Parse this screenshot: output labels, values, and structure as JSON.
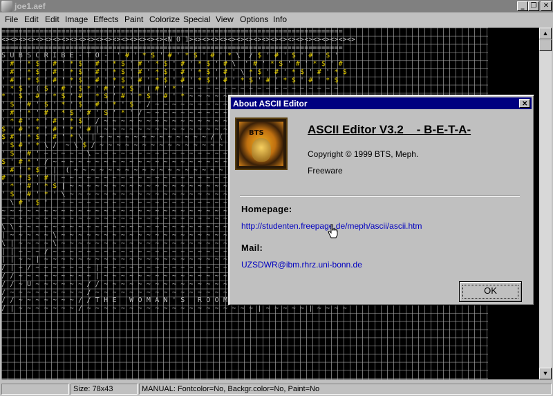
{
  "window": {
    "title": "joe1.aef",
    "controls": [
      "minimize",
      "restore",
      "close"
    ]
  },
  "menu": [
    "File",
    "Edit",
    "Edit",
    "Image",
    "Effects",
    "Paint",
    "Colorize",
    "Special",
    "View",
    "Options",
    "Info"
  ],
  "canvas": {
    "rows": [
      "================================================================================",
      "<><><><><><><><><><><><><><><><><><><><N 0 1><><><><><><><><><><><><><><><><><><><>",
      "================================================================================",
      "S U B S C R I B E - T O -  ' # ' * $ ' # ' * $ ' # ' * \\  / $ ' # ' $ ' # ' $ '",
      "' # ' * $ ' # ' * $ ' # ' * $ ' # ' * $ ' # ' * $ ' # \\  ' # ' * $ ' # ' * $ ' #",
      "' # ' * $ ' # ' * $ ' # ' * $ ' # ' * $ ' # ' * $ ' # ' \\ * $ ' # ' * $ ' # ' * $",
      "' # ' * $ ' # ' * $ ' # ' * $ ' # ' * $ ' # ' * $ ' # ' * $ ' # ' * $ ' # ' * $",
      "' * $ ' ( $ ' # ' $ * ' # ' * $ ' ( # ' * ' ~ ~ ~ ~ ~ ~ ~ ~ ~ ~ ~ ~ ~ ~ ~ ~ ~ ~",
      "* ' $ ' # ' * $ ' # ' * $ ' # ' * $ ' # ' * ~ ~ ~ ~ ~ ~ ~ ~ ~ ~ ~ ~ ~ ~ ~ ~ ~ ~ ~",
      "' $ ' # ' $ ' * ' $ ' # ' * ' $ ' / ~ ~ ~ ~ ~ ~ ~ ~ ~ ~ ~ ~ ~ ~ ~ ~ ~ ~ ~ ~ ~ ~ ~",
      "' # ' * ' # ' * $ ' # ' $ ' * ' / ~ ~ ~ ~ ~ ~ ~ ~ ~ ~ ~ ~ ~ ~ ~ ~ ~ ~ ~ ~ ~ ~ ~ ~",
      "' * # ' * ' # ' * $ ' / ~ ~ ~ ~ ~ ~ ~ ~ ~ ~ ~ ~ ~ ~ ~ ~ ~ ~ ~ ~ ~ ~ ~ ~ ~ ~ ~ ~ ~",
      "$ ' # ' * ' # ' * ' # | ~ ~ ~ ~ ~ ~ ~ ~ ~ ~ ~ ~ ~ ~ ~ ~ ~ ~ ~ ~ ~ ~ ~ ~ ~ ~ ~ ~ ~",
      "$ # ' * $ ' # ' * \\  | ~ ~ ~ ~ ~ ~ ~ ~ ~ ~ ~ ~ ~ / ( 0 | ~ ~ ~ ~ ~ ~ ~ ~ ~ ~ ~ ~",
      "' $ # ' * \\ /  ~ \\ $ / ~ ~ ~ ~ ~ ~ ~ ~ ~ ~ ~ ~ ~ ~ ~ ~ ~ ~ ~ ~ ~ ~ ~ ~ ~ ~ ~ ~ ~",
      "' $ ' # ' ~ ~ ~ ~ ~ \\ ~ ~ ~ ~ ~ ~ ~ ~ ~ ~ ~ ~ ~ ~ ~ ~ ~ ~ ~ ~ ~ ~ ~ ~ ~ ~ ~ ~ ~",
      "$ ' # * ' / ~ ~ ~ ~ ~ ~ ~ ~ ~ ~ ~ ~ ~ ~ ~ ~ ~ ~ ~ ~ ~ ~ ~ ~ ~ ~ ~ ~ ~ ~ ~ ~ ~ ~",
      "' # ' * $ ' |  ( ~ ~ ~ ~ ~ ~ ~ ~ ~ ~ ~ ~ ~ ~ ~ ~ ~ ~ ~ ~ ~ ~ ~ ~ ~ ~ ~ ~ ~ ~ ~ ~",
      "# ' * $ ' # | ~ ~ ~ ~ ~ ~ ~ ~ ~ ~ ~ ~ ~ ~ ~ ~ ~ ~ ~ ~ ~ ~ ~ ~ ~ ~ ~ ~ ~ ~ ~ ~ ~",
      "' * ' # ' * $ | ~ ~ ~ ~ ~ ~ ~ ~ ~ ~ ~ ~ ~ ~ ~ ~ ~ ~ ~ ~ ~ ~ ~ ~ ~ ~ ~ ~ ~ ~ ~ ~",
      "' $ ' # ' * ' \\ ~ ~ ~ ~ ~ ~ ~ ~ ~ ~ ~ ~ ~ ~ ~ ~ ~ ~ ~ ~ ~ ~ ~ ~ ~ ~ ~ ~ ~ ~ ~ ~",
      "  \\ # ' $ '   ~ ~ ~ ~ ~ ~ ~ ~ ~ ~ ~ ~ ~ ~ ~ ~ ~ ~ ~ ~ ~ ~ ~ ~ ~ ~ ~ ~ ~ ~ ~ ~ ~",
      "~ ~ ~ ~ ~ ~ ~ ~ ~ ~ ~ ~ ~ ~ ~ ~ ~ ~ ~ ~ ~ ~ ~ ~ ~ ~ ~ ~ ~ ~ ~ ~ ~ ~ ~ ~ ~ ~ ~ ~",
      "~ ~ ~ ~ ~ ~ ~ ~ ~ ~ ~ ~ ~ ~ ~ ~ ~ ~ ~ ~ ~ ~ ~ ~ ~ ~ ~ ~ ~ ~ ~ ~ ~ ~ ~ ~ ~ ~ ~ ~",
      "\\ \\ ~ ~ ~ ~ ~ ~ ~ ~ ~ ~ ~ ~ ~ ~ ~ ~ ~ ~ ~ ~ ~ ~ ~ ~ ~ ~ ~ ~ ~ ~ ~ ~ ~ ~ ~ ~ ~ ~",
      "| ~ ~ ~ ~ ~ \\ ~ ~ ~ ~ ~ ~ ~ ~ ~ ~ ~ ~ ~ ~ ~ ~ ~ ~ ~ ~ ~ ~ ~ ~ ~ ~ ~ ~ ~ ~ ~ ~ ~",
      "\\ | ~ ~ ~ ~ \\ ~ ~ ~ ~ ~ ~ ~ ~ ~ ~ ~ ~ ~ ~ ~ ~ ~ ~ ~ ~ ~ ~ ~ ~ ~ ~ ~ ~ ~ ~ ~ ~ ~",
      "| | ~ ~ ~ / ~ ~ ~ ~ ~ ~ ~ ~ ~ ~ ~ ~ ~ ~ ~ ~ ~ ~ ~ ~ ~ ~ ~ ~ ~ ~ ~ ~ ~ ~ ~ ~ ~ ~",
      "| | ~ ~ | ~ ~ ~ ~ ~ ~ ~ ~ ~ ~ ~ ~ ~ ~ ~ ~ ~ ~ ~ ~ ~ ~ ~ ~ ~ ~ \\ ~ / ~ | ~ ~ ~ ~",
      "/ | ~ / ~ ~ ~ ~ ~ ~ ~ | ~ ~ ~ ~ ~ ~ ~ ~ ~ ~ ~ ~ ~ ~ ~ ~ ~ ~ ~ ~ ~ ~ ~ | ~ ~ ~ ~",
      "/ / ~ ~ ~ ~ ~ ~ ~ ~ ~ | ~ ~ ~ ~ ~ ~ ~ ~ ~ ~ ~ ~ ~ ~ ~ ~ ~ ~ \\ ~ ~ ~ ~ | ~ ~ ~ ~",
      "/ / ~ U ~ ~ ~ ~ ~ ~ / / ~ ~ ~ ~ ~ ~ ~ ~ ~ ~ ~ ~ ~ ~ ~ ~ ~ ~ ~ U ~ ~ ~ | ~ ~ ~ ~",
      "/ ~ ~ ~ ~ ~ ~ ~ ~ ~ / ~ ~ ~ ~ ~ ~ ~ ~ ~ ~ ~ ~ ~ ~ ~ ~ ~ ~ ~ ~ ~ ~ ~ ~ | ~ ~ ~ ~",
      "/ / ~ ~ ~ ~ ~ ~ ~ / / T H E   W O M A N ' S   R O O M ~ ~ ( ~ ~ ~ U ~ ~ | ~ ~ ~ ~",
      "/ | ~ ~ ~ ~ ~ ~ ~ / ~ ~ ~ ~ ~ ~ ~ ~ ~ ~ ~ ~ ~ ~ ~ ~ ~ ~ ~ ~ | ~ ~ ~ ~ ~ | ~ ~ ~ ~"
    ]
  },
  "status": {
    "cell1": "",
    "size": "Size: 78x43",
    "mode": "MANUAL:   Fontcolor=No,  Backgr.color=No,  Paint=No"
  },
  "about_dialog": {
    "title": "About ASCII Editor",
    "logo_text": "BTS",
    "heading": "ASCII Editor V3.2    - B-E-T-A-",
    "copyright": "Copyright © 1999 BTS, Meph.",
    "license": "Freeware",
    "homepage_label": "Homepage:",
    "homepage_url": "http://studenten.freepage.de/meph/ascii/ascii.htm",
    "mail_label": "Mail:",
    "mail_address": "UZSDWR@ibm.rhrz.uni-bonn.de",
    "ok_label": "OK"
  },
  "colors": {
    "dialog_title_bg": "#000080",
    "link": "#0000c0",
    "canvas_bg": "#000000",
    "ascii_yellow": "#e8d000",
    "ascii_red": "#e03030"
  }
}
